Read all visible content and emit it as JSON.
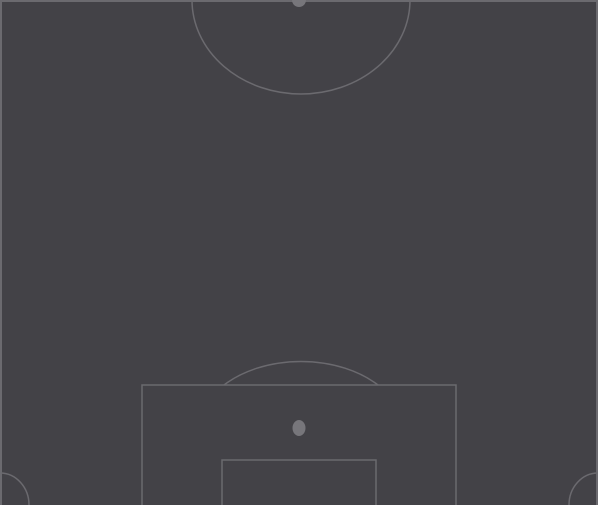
{
  "pitch": {
    "view": "half-pitch",
    "theme": "dark",
    "colors": {
      "background": "#434247",
      "lines": "#6b6a6f",
      "spots": "#77767b"
    },
    "markings": [
      "centre-circle",
      "centre-spot",
      "penalty-area",
      "goal-area",
      "penalty-arc",
      "penalty-spot",
      "corner-arc-left",
      "corner-arc-right",
      "touchline-left",
      "touchline-right",
      "halfway-line"
    ]
  }
}
